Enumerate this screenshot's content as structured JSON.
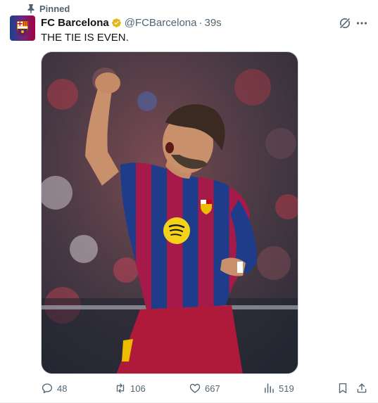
{
  "pinned_label": "Pinned",
  "tweet": {
    "author_name": "FC Barcelona",
    "handle": "@FCBarcelona",
    "separator": "·",
    "time": "39s",
    "text": "THE TIE IS EVEN.",
    "media_alt": "FC Barcelona player celebrating with a raised fist",
    "stats": {
      "replies": "48",
      "reposts": "106",
      "likes": "667",
      "views": "519"
    }
  },
  "colors": {
    "text_primary": "#0f1419",
    "text_secondary": "#536471",
    "verified_gold": "#e2b719",
    "barca_blue": "#1b3f8f",
    "barca_red": "#a50044"
  },
  "icons": {
    "pin": "pin-icon",
    "verified": "verified-badge-icon",
    "grok": "grok-icon",
    "more": "more-icon",
    "reply": "reply-icon",
    "repost": "repost-icon",
    "like": "heart-icon",
    "views": "views-icon",
    "bookmark": "bookmark-icon",
    "share": "share-icon"
  }
}
